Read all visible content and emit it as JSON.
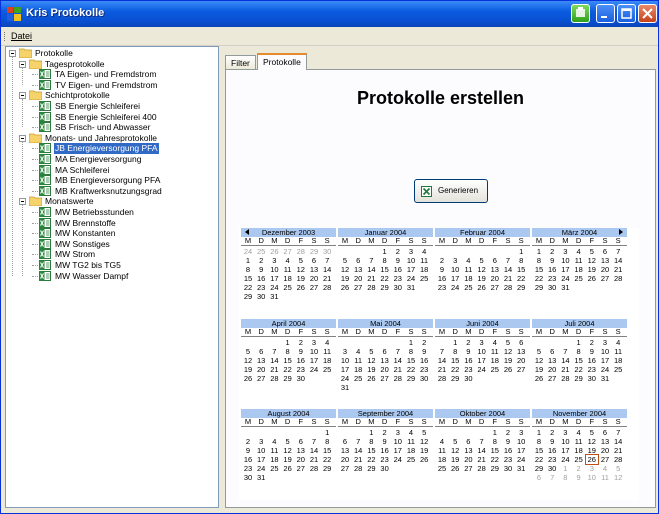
{
  "window": {
    "title": "Kris Protokolle"
  },
  "menu": {
    "datei": "Datei"
  },
  "tree": [
    {
      "label": "Protokolle",
      "kind": "folder",
      "level": 0,
      "toggle": true
    },
    {
      "label": "Tagesprotokolle",
      "kind": "folder",
      "level": 1,
      "toggle": true
    },
    {
      "label": "TA Eigen- und Fremdstrom",
      "kind": "report",
      "level": 2
    },
    {
      "label": "TV Eigen- und Fremdstrom",
      "kind": "report",
      "level": 2
    },
    {
      "label": "Schichtprotokolle",
      "kind": "folder",
      "level": 1,
      "toggle": true
    },
    {
      "label": "SB Energie Schleiferei",
      "kind": "report",
      "level": 2
    },
    {
      "label": "SB Energie Schleiferei 400",
      "kind": "report",
      "level": 2
    },
    {
      "label": "SB Frisch- und Abwasser",
      "kind": "report",
      "level": 2
    },
    {
      "label": "Monats- und Jahresprotokolle",
      "kind": "folder",
      "level": 1,
      "toggle": true
    },
    {
      "label": "JB Energieversorgung PFA",
      "kind": "report",
      "level": 2,
      "selected": true
    },
    {
      "label": "MA Energieversorgung",
      "kind": "report",
      "level": 2
    },
    {
      "label": "MA Schleiferei",
      "kind": "report",
      "level": 2
    },
    {
      "label": "MB Energieversorgung PFA",
      "kind": "report",
      "level": 2
    },
    {
      "label": "MB Kraftwerksnutzungsgrad",
      "kind": "report",
      "level": 2
    },
    {
      "label": "Monatswerte",
      "kind": "folder",
      "level": 1,
      "toggle": true
    },
    {
      "label": "MW Betriebsstunden",
      "kind": "report",
      "level": 2
    },
    {
      "label": "MW Brennstoffe",
      "kind": "report",
      "level": 2
    },
    {
      "label": "MW Konstanten",
      "kind": "report",
      "level": 2
    },
    {
      "label": "MW Sonstiges",
      "kind": "report",
      "level": 2
    },
    {
      "label": "MW Strom",
      "kind": "report",
      "level": 2
    },
    {
      "label": "MW TG2 bis TG5",
      "kind": "report",
      "level": 2
    },
    {
      "label": "MW Wasser Dampf",
      "kind": "report",
      "level": 2
    }
  ],
  "tabs": {
    "filter": "Filter",
    "protokolle": "Protokolle"
  },
  "main": {
    "heading": "Protokolle erstellen",
    "generate_label": "Generieren"
  },
  "calendar": {
    "dow": [
      "M",
      "D",
      "M",
      "D",
      "F",
      "S",
      "S"
    ],
    "months": [
      {
        "name": "Dezember 2003",
        "lead": [
          "24",
          "25",
          "26",
          "27",
          "28",
          "29",
          "30"
        ],
        "days": 31,
        "start": 0,
        "trail": []
      },
      {
        "name": "Januar 2004",
        "lead": [],
        "days": 31,
        "start": 3,
        "trail": []
      },
      {
        "name": "Februar 2004",
        "lead": [],
        "days": 29,
        "start": 6,
        "trail": []
      },
      {
        "name": "März 2004",
        "lead": [],
        "days": 31,
        "start": 0,
        "trail": []
      },
      {
        "name": "April 2004",
        "lead": [],
        "days": 30,
        "start": 3,
        "trail": []
      },
      {
        "name": "Mai 2004",
        "lead": [],
        "days": 31,
        "start": 5,
        "trail": []
      },
      {
        "name": "Juni 2004",
        "lead": [],
        "days": 30,
        "start": 1,
        "trail": []
      },
      {
        "name": "Juli 2004",
        "lead": [],
        "days": 31,
        "start": 3,
        "trail": []
      },
      {
        "name": "August 2004",
        "lead": [],
        "days": 31,
        "start": 6,
        "trail": []
      },
      {
        "name": "September 2004",
        "lead": [],
        "days": 30,
        "start": 2,
        "trail": []
      },
      {
        "name": "Oktober 2004",
        "lead": [],
        "days": 31,
        "start": 4,
        "trail": []
      },
      {
        "name": "November 2004",
        "lead": [],
        "days": 30,
        "start": 0,
        "today": 26,
        "trail": [
          "1",
          "2",
          "3",
          "4",
          "5",
          "6",
          "7",
          "8",
          "9",
          "10",
          "11",
          "12"
        ]
      }
    ]
  }
}
